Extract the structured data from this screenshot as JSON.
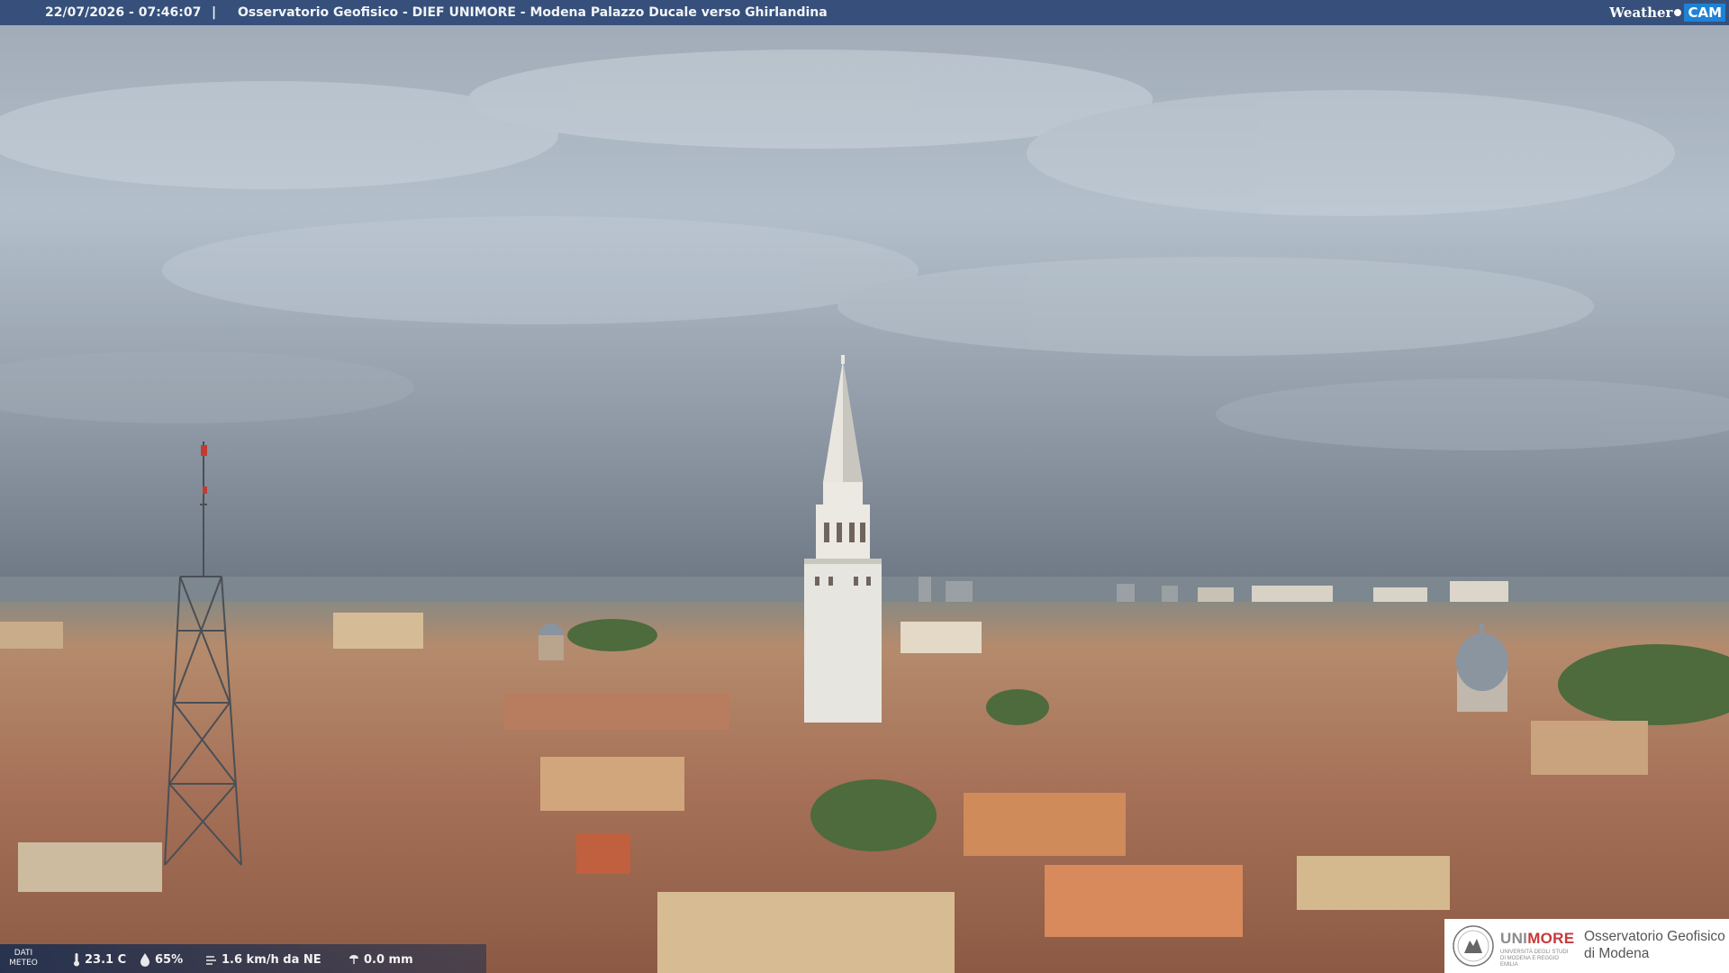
{
  "header": {
    "datetime": "22/07/2026 - 07:46:07",
    "separator": "|",
    "title": "Osservatorio Geofisico - DIEF UNIMORE - Modena Palazzo Ducale verso Ghirlandina",
    "brand_weather": "Weather",
    "brand_cam": "CAM"
  },
  "weather": {
    "label_line1": "DATI",
    "label_line2": "METEO",
    "temperature": "23.1 C",
    "humidity": "65%",
    "wind": "1.6 km/h da NE",
    "rain": "0.0 mm",
    "icons": [
      "thermometer-icon",
      "humidity-drop-icon",
      "wind-icon",
      "rain-icon"
    ]
  },
  "logo": {
    "uni_a": "UNI",
    "uni_b": "MORE",
    "uni_sub": "UNIVERSITÀ DEGLI STUDI DI MODENA E REGGIO EMILIA",
    "observatory_line1": "Osservatorio Geofisico",
    "observatory_line2": "di Modena"
  },
  "colors": {
    "header_bar": "#1e3c6e",
    "brand_cam": "#1e82d6",
    "unimore_red": "#c8373a",
    "sky": "#a9b7c5",
    "roofs": "#a9765a"
  }
}
